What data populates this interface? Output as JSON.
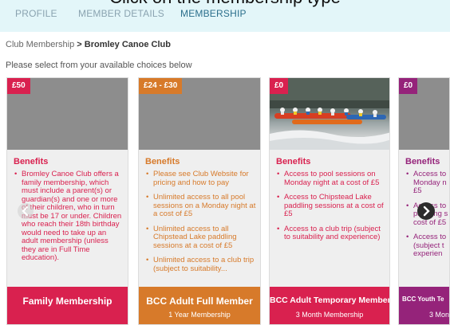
{
  "instruction": "Click on the membership type",
  "tabs": [
    {
      "label": "PROFILE"
    },
    {
      "label": "MEMBER DETAILS"
    },
    {
      "label": "MEMBERSHIP"
    }
  ],
  "breadcrumb": {
    "parent": "Club Membership",
    "separator": ">",
    "current": "Bromley Canoe Club"
  },
  "intro_text": "Please select from your available choices below",
  "benefits_heading": "Benefits",
  "colors": {
    "crimson": "#d9214f",
    "orange": "#d77a2a",
    "purple": "#95237a"
  },
  "nav": {
    "prev_icon": "chevron-left-icon",
    "next_icon": "chevron-right-icon"
  },
  "cards": [
    {
      "price": "£50",
      "image_icon": "grey-placeholder-image",
      "benefits": [
        "Bromley Canoe Club offers a family membership, which must include a parent(s) or guardian(s) and one or more of their children, who in turn must be 17 or under. Children who reach their 18th birthday would need to take up an adult membership (unless they are in Full Time education)."
      ],
      "name": "Family Membership",
      "subtitle": ""
    },
    {
      "price": "£24 - £30",
      "image_icon": "grey-placeholder-image",
      "benefits": [
        "Please see Club Website for pricing and how to pay",
        "Unlimited access to all pool sessions on a Monday night at a cost of £5",
        "Unlimited access to all Chipstead Lake paddling sessions at a cost of £5",
        "Unlimited access to a club trip (subject to suitability..."
      ],
      "name": "BCC Adult Full Member",
      "subtitle": "1 Year Membership"
    },
    {
      "price": "£0",
      "image_icon": "kayak-photo",
      "benefits": [
        "Access to pool sessions on Monday night at a cost of £5",
        "Access to Chipstead Lake paddling sessions at a cost of £5",
        "Access to a club trip (subject to suitability and experience)"
      ],
      "name": "BCC Adult Temporary Member",
      "subtitle": "3 Month Membership"
    },
    {
      "price": "£0",
      "image_icon": "grey-placeholder-image",
      "benefits": [
        "Access to Monday n £5",
        "Access to paddling s cost of £5",
        "Access to (subject t experien"
      ],
      "name": "BCC Youth Te",
      "subtitle": "3 Mont"
    }
  ]
}
